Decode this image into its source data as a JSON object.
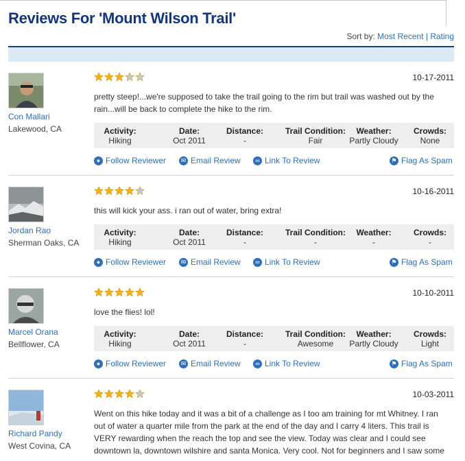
{
  "page": {
    "title": "Reviews For 'Mount Wilson Trail'"
  },
  "sort": {
    "label": "Sort by:",
    "options": [
      "Most Recent",
      "Rating"
    ],
    "separator": "|"
  },
  "stat_headers": [
    "Activity:",
    "Date:",
    "Distance:",
    "Trail Condition:",
    "Weather:",
    "Crowds:"
  ],
  "actions": {
    "follow": "Follow Reviewer",
    "email": "Email Review",
    "link": "Link To Review",
    "flag": "Flag As Spam"
  },
  "colors": {
    "title": "#12367a",
    "link": "#2f6fb8",
    "star_on": "#f2b01e",
    "star_off": "#c8c8c8",
    "bar": "#dceaf8"
  },
  "reviews": [
    {
      "name": "Con Mallari",
      "location": "Lakewood, CA",
      "rating": 3,
      "date": "10-17-2011",
      "text": "pretty steep!...we're supposed to take the trail going to the rim but trail was washed out by the rain...will be back to complete the hike to the rim.",
      "stats": [
        "Hiking",
        "Oct 2011",
        "-",
        "Fair",
        "Partly Cloudy",
        "None"
      ]
    },
    {
      "name": "Jordan Rao",
      "location": "Sherman Oaks, CA",
      "rating": 4,
      "date": "10-16-2011",
      "text": "this will kick your ass. i ran out of water, bring extra!",
      "stats": [
        "Hiking",
        "Oct 2011",
        "-",
        "-",
        "-",
        "-"
      ]
    },
    {
      "name": "Marcel Orana",
      "location": "Bellflower, CA",
      "rating": 5,
      "date": "10-10-2011",
      "text": "love the flies! lol!",
      "stats": [
        "Hiking",
        "Oct 2011",
        "-",
        "Awesome",
        "Partly Cloudy",
        "Light"
      ]
    },
    {
      "name": "Richard Pandy",
      "location": "West Covina, CA",
      "rating": 4,
      "date": "10-03-2011",
      "text": "Went on this hike today and it was a bit of a challenge as I too am training for mt Whitney. I ran out of water a quarter mile from the park at the end of the day and I carry 4 liters. This trail is VERY rewarding when the reach the top and see the view. Today was clear and I could see downtown la, downtown wilshire and santa Monica. Very cool. Not for beginners and I saw some",
      "stats": []
    }
  ]
}
